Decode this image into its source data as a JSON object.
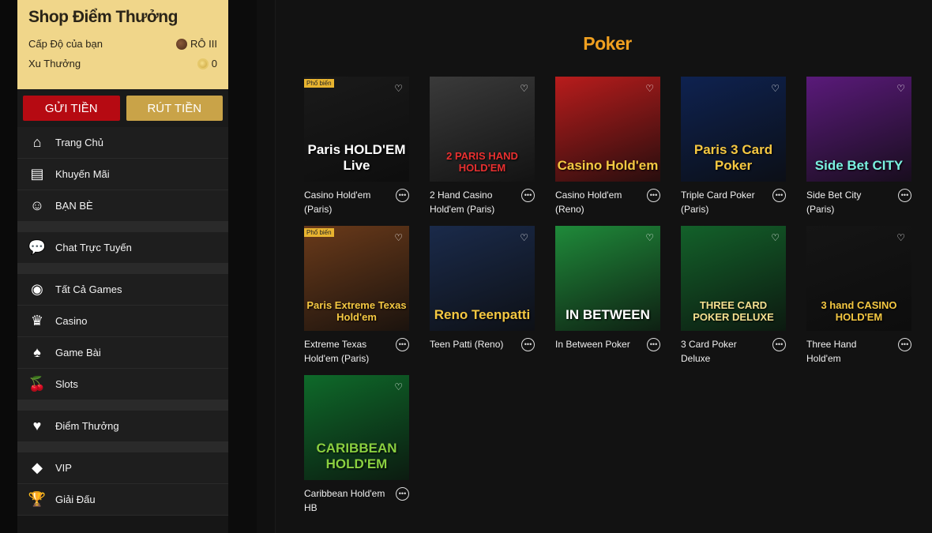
{
  "shop": {
    "title": "Shop Điểm Thưởng",
    "level_label": "Cấp Độ của bạn",
    "level_value": "RÔ III",
    "points_label": "Xu Thưởng",
    "points_value": "0"
  },
  "buttons": {
    "deposit": "GỬI TIỀN",
    "withdraw": "RÚT TIỀN"
  },
  "menu": [
    {
      "label": "Trang Chủ",
      "icon": "home-icon",
      "glyph": "⌂"
    },
    {
      "label": "Khuyến Mãi",
      "icon": "newspaper-icon",
      "glyph": "▤"
    },
    {
      "label": "BẠN BÈ",
      "icon": "friends-icon",
      "glyph": "☺"
    },
    {
      "label": "Chat Trực Tuyến",
      "icon": "chat-icon",
      "glyph": "💬"
    },
    {
      "label": "Tất Cả Games",
      "icon": "chip-icon",
      "glyph": "◉"
    },
    {
      "label": "Casino",
      "icon": "casino-icon",
      "glyph": "♛"
    },
    {
      "label": "Game Bài",
      "icon": "cards-icon",
      "glyph": "♠"
    },
    {
      "label": "Slots",
      "icon": "cherry-icon",
      "glyph": "🍒"
    },
    {
      "label": "Điểm Thưởng",
      "icon": "heart-icon",
      "glyph": "♥"
    },
    {
      "label": "VIP",
      "icon": "diamond-icon",
      "glyph": "◆"
    },
    {
      "label": "Giải Đấu",
      "icon": "trophy-icon",
      "glyph": "🏆"
    }
  ],
  "section_title": "Poker",
  "badge_text": "Phổ biến",
  "games": [
    {
      "title": "Casino Hold'em (Paris)",
      "art": "Paris HOLD'EM Live",
      "bg": "#1a1a1a",
      "accent": "#ffffff",
      "badge": true
    },
    {
      "title": "2 Hand Casino Hold'em (Paris)",
      "art": "2 PARIS HAND HOLD'EM",
      "bg": "#3a3a3a",
      "accent": "#e83030",
      "badge": false
    },
    {
      "title": "Casino Hold'em (Reno)",
      "art": "Casino Hold'em",
      "bg": "#b81c1c",
      "accent": "#f5c842",
      "badge": false
    },
    {
      "title": "Triple Card Poker (Paris)",
      "art": "Paris 3 Card Poker",
      "bg": "#0e2250",
      "accent": "#f5c842",
      "badge": false
    },
    {
      "title": "Side Bet City (Paris)",
      "art": "Side Bet CITY",
      "bg": "#5a1a7a",
      "accent": "#7af0e0",
      "badge": false
    },
    {
      "title": "Extreme Texas Hold'em (Paris)",
      "art": "Paris Extreme Texas Hold'em",
      "bg": "#6a3a1a",
      "accent": "#f5c842",
      "badge": true
    },
    {
      "title": "Teen Patti (Reno)",
      "art": "Reno Teenpatti",
      "bg": "#1a2a4a",
      "accent": "#f5c842",
      "badge": false
    },
    {
      "title": "In Between Poker",
      "art": "IN BETWEEN",
      "bg": "#1f8a3a",
      "accent": "#ffffff",
      "badge": false
    },
    {
      "title": "3 Card Poker Deluxe",
      "art": "THREE CARD POKER DELUXE",
      "bg": "#13612a",
      "accent": "#f5e090",
      "badge": false
    },
    {
      "title": "Three Hand Hold'em",
      "art": "3 hand CASINO HOLD'EM",
      "bg": "#151515",
      "accent": "#f5c842",
      "badge": false
    },
    {
      "title": "Caribbean Hold'em HB",
      "art": "CARIBBEAN HOLD'EM",
      "bg": "#0e6a2a",
      "accent": "#8ad040",
      "badge": false
    }
  ],
  "colors": {
    "accent_orange": "#f0a020",
    "deposit_red": "#b60a12",
    "withdraw_gold": "#c9a348",
    "shop_bg": "#f0d68a"
  }
}
